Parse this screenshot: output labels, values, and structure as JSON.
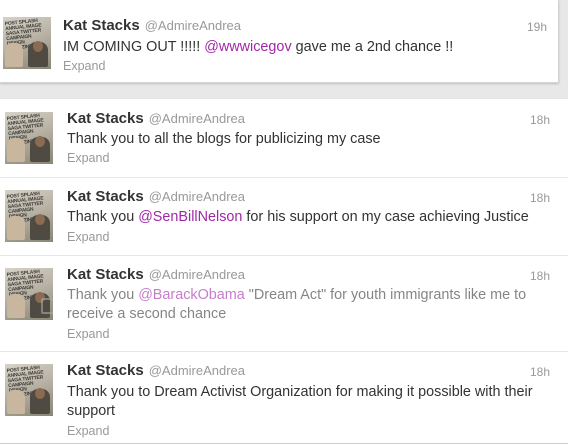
{
  "tweets": [
    {
      "name": "Kat Stacks",
      "handle": "@AdmireAndrea",
      "time": "19h",
      "text_before": "IM COMING OUT !!!!! ",
      "mention": "@wwwicegov",
      "text_after": " gave me a 2nd chance !!",
      "expand": "Expand"
    },
    {
      "name": "Kat Stacks",
      "handle": "@AdmireAndrea",
      "time": "18h",
      "text_before": "Thank you to all the blogs for publicizing my case",
      "mention": "",
      "text_after": "",
      "expand": "Expand"
    },
    {
      "name": "Kat Stacks",
      "handle": "@AdmireAndrea",
      "time": "18h",
      "text_before": "Thank you ",
      "mention": "@SenBillNelson",
      "text_after": " for his support on my case achieving Justice",
      "expand": "Expand"
    },
    {
      "name": "Kat Stacks",
      "handle": "@AdmireAndrea",
      "time": "18h",
      "text_before": "Thank you ",
      "mention": "@BarackObama",
      "text_after": " \"Dream Act\" for youth immigrants like me to receive a second chance",
      "expand": "Expand"
    },
    {
      "name": "Kat Stacks",
      "handle": "@AdmireAndrea",
      "time": "18h",
      "text_before": "Thank you to Dream Activist Organization for making it possible with their support",
      "mention": "",
      "text_after": "",
      "expand": "Expand"
    }
  ],
  "avatar_text": "POST SPLASH ANNUAL IMAGE SAGA TWITTER CAMPAIGN DESIGN MAGAZINE",
  "colors": {
    "mention": "#a028a8",
    "name": "#333333",
    "muted": "#999999"
  }
}
